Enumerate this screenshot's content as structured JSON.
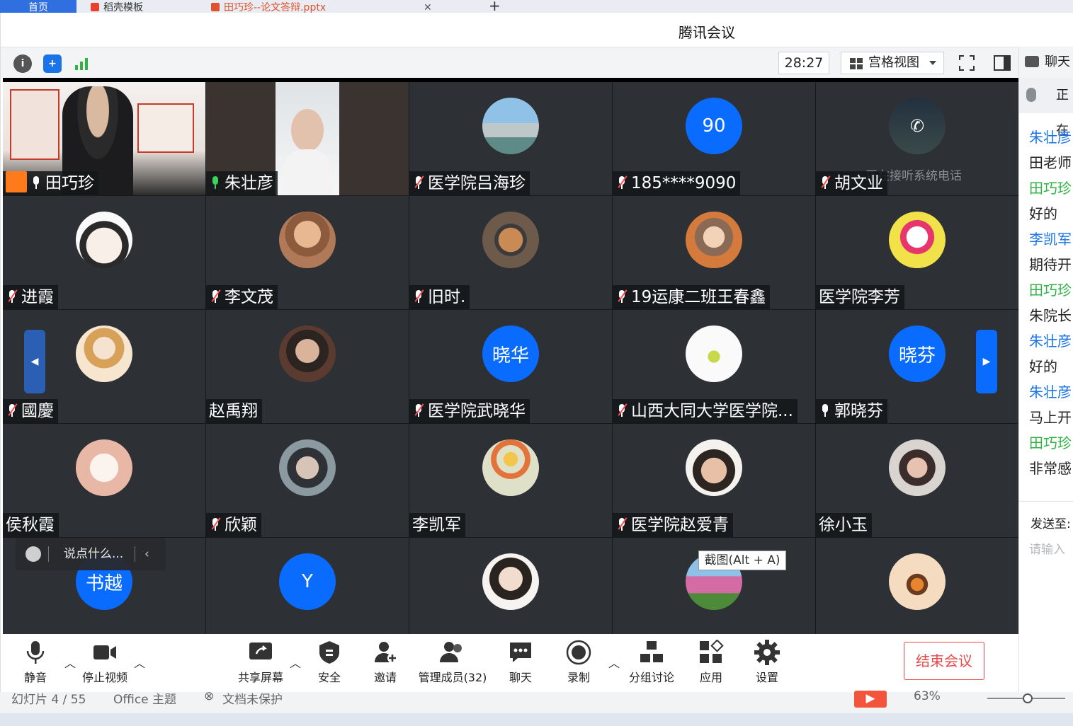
{
  "browser": {
    "tabs": [
      {
        "label": "首页",
        "active": true
      },
      {
        "label": "稻壳模板",
        "active": false
      },
      {
        "label": "田巧珍--论文答辩.pptx",
        "active": false
      }
    ],
    "new_tab": "+"
  },
  "window": {
    "title": "腾讯会议",
    "timer": "28:27",
    "view_mode": "宫格视图",
    "chat_tab": "聊天"
  },
  "participants": [
    {
      "name": "田巧珍",
      "mic": "on",
      "host": true,
      "type": "video"
    },
    {
      "name": "朱壮彦",
      "mic": "speaking",
      "type": "video"
    },
    {
      "name": "医学院吕海珍",
      "mic": "muted",
      "type": "photo"
    },
    {
      "name": "185****9090",
      "mic": "muted",
      "type": "letter",
      "letter": "90"
    },
    {
      "name": "胡文业",
      "mic": "muted",
      "type": "photo",
      "note": "正在接听系统电话"
    },
    {
      "name": "进霞",
      "mic": "muted",
      "type": "photo"
    },
    {
      "name": "李文茂",
      "mic": "muted",
      "type": "photo"
    },
    {
      "name": "旧时.",
      "mic": "muted",
      "type": "photo"
    },
    {
      "name": "19运康二班王春鑫",
      "mic": "muted",
      "type": "photo"
    },
    {
      "name": "医学院李芳",
      "mic": "none",
      "type": "photo"
    },
    {
      "name": "國慶",
      "mic": "muted",
      "type": "photo"
    },
    {
      "name": "赵禹翔",
      "mic": "none",
      "type": "photo"
    },
    {
      "name": "医学院武晓华",
      "mic": "muted",
      "type": "letter",
      "letter": "晓华"
    },
    {
      "name": "山西大同大学医学院...",
      "mic": "muted",
      "type": "photo"
    },
    {
      "name": "郭晓芬",
      "mic": "on",
      "type": "letter",
      "letter": "晓芬"
    },
    {
      "name": "侯秋霞",
      "mic": "none",
      "type": "photo"
    },
    {
      "name": "欣颖",
      "mic": "muted",
      "type": "photo"
    },
    {
      "name": "李凯军",
      "mic": "none",
      "type": "photo"
    },
    {
      "name": "医学院赵爱青",
      "mic": "muted",
      "type": "photo"
    },
    {
      "name": "徐小玉",
      "mic": "none",
      "type": "photo"
    },
    {
      "name": "",
      "mic": "none",
      "type": "letter",
      "letter": "书越"
    },
    {
      "name": "",
      "mic": "none",
      "type": "letter",
      "letter": "Y"
    },
    {
      "name": "",
      "mic": "none",
      "type": "photo"
    },
    {
      "name": "",
      "mic": "none",
      "type": "photo"
    },
    {
      "name": "",
      "mic": "none",
      "type": "photo"
    }
  ],
  "overlay": {
    "say_placeholder": "说点什么...",
    "tooltip": "截图(Alt + A)"
  },
  "chat": {
    "status": "正在",
    "messages": [
      {
        "text": "朱壮彦",
        "color": "#1a73e8"
      },
      {
        "text": "田老师",
        "color": "#222222"
      },
      {
        "text": "田巧珍",
        "color": "#2fb344"
      },
      {
        "text": "好的",
        "color": "#222222"
      },
      {
        "text": "李凯军",
        "color": "#1a73e8"
      },
      {
        "text": "期待开",
        "color": "#222222"
      },
      {
        "text": "田巧珍",
        "color": "#2fb344"
      },
      {
        "text": "朱院长",
        "color": "#222222"
      },
      {
        "text": "朱壮彦",
        "color": "#1a73e8"
      },
      {
        "text": "好的",
        "color": "#222222"
      },
      {
        "text": "朱壮彦",
        "color": "#1a73e8"
      },
      {
        "text": "马上开",
        "color": "#222222"
      },
      {
        "text": "田巧珍",
        "color": "#2fb344"
      },
      {
        "text": "非常感",
        "color": "#222222"
      }
    ],
    "send_to": "发送至:",
    "input_placeholder": "请输入"
  },
  "controls": {
    "mute": "静音",
    "stop_video": "停止视频",
    "share": "共享屏幕",
    "security": "安全",
    "invite": "邀请",
    "members": "管理成员(32)",
    "chat": "聊天",
    "record": "录制",
    "breakout": "分组讨论",
    "apps": "应用",
    "settings": "设置",
    "end": "结束会议"
  },
  "ppt_status": {
    "slide": "幻灯片 4 / 55",
    "theme": "Office 主题",
    "protect": "文档未保护",
    "zoom": "63%"
  },
  "colors": {
    "accent": "#0a6cff",
    "end_red": "#e84a4a",
    "speaking_green": "#3bd35a"
  }
}
